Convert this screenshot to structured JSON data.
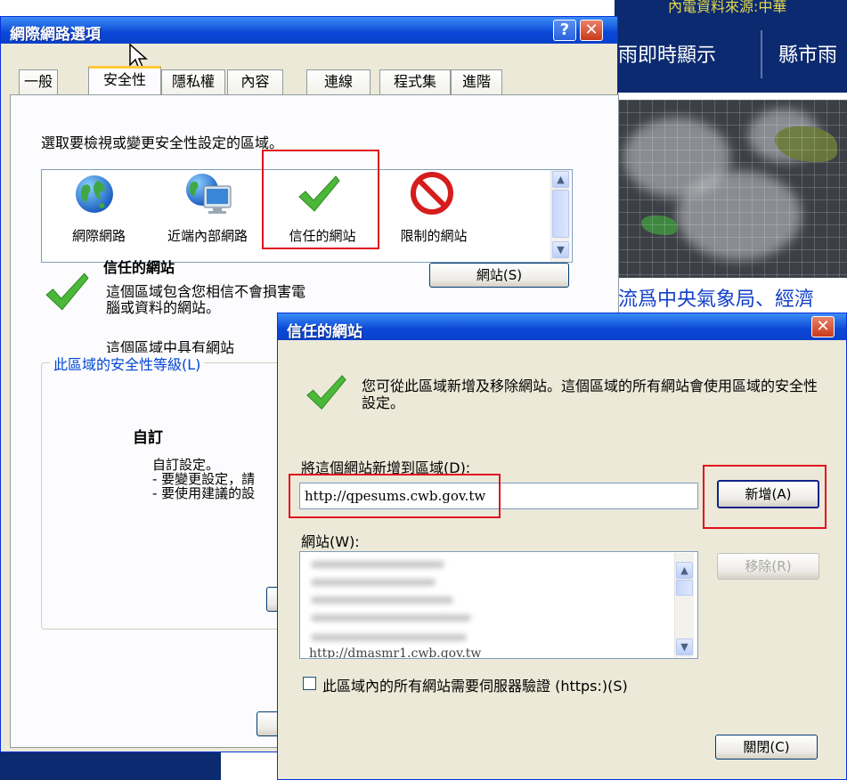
{
  "background_page": {
    "top_text": "內電資料來源:中華",
    "nav": [
      "即時顯示",
      "縣市雨"
    ],
    "nav_prefix": "雨",
    "link_text": "流爲中央氣象局、經濟"
  },
  "internet_options": {
    "title": "網際網路選項",
    "help_button": "?",
    "close_button": "✕",
    "tabs": [
      "一般",
      "安全性",
      "隱私權",
      "內容",
      "連線",
      "程式集",
      "進階"
    ],
    "active_tab": "安全性",
    "zone_prompt": "選取要檢視或變更安全性設定的區域。",
    "zones": [
      {
        "label": "網際網路",
        "icon": "globe-icon"
      },
      {
        "label": "近端內部網路",
        "icon": "intranet-icon"
      },
      {
        "label": "信任的網站",
        "icon": "checkmark-icon",
        "selected": true
      },
      {
        "label": "限制的網站",
        "icon": "restricted-icon"
      }
    ],
    "selected_zone_title": "信任的網站",
    "selected_zone_desc": "這個區域包含您相信不會損害電腦或資料的網站。",
    "sites_button": "網站(S)",
    "zone_has_sites": "這個區域中具有網站",
    "security_level_group": "此區域的安全性等級(L)",
    "level_title": "自訂",
    "level_desc": [
      "自訂設定。",
      "- 要變更設定，請",
      "- 要使用建議的設"
    ]
  },
  "trusted_sites": {
    "title": "信任的網站",
    "close_button": "✕",
    "info_text": "您可從此區域新增及移除網站。這個區域的所有網站會使用區域的安全性設定。",
    "add_label": "將這個網站新增到區域(D):",
    "add_input_value": "http://qpesums.cwb.gov.tw",
    "add_button": "新增(A)",
    "websites_label": "網站(W):",
    "websites_partial": "http://dmasmr1.cwb.gov.tw",
    "remove_button": "移除(R)",
    "https_checkbox": "此區域內的所有網站需要伺服器驗證 (https:)(S)",
    "https_checked": false,
    "close_dialog_button": "關閉(C)"
  },
  "colors": {
    "titlebar": "#0a46d6",
    "highlight_box": "#e0101e",
    "dialog_bg": "#ece9d8",
    "bg_nav": "#0b2a6f"
  }
}
